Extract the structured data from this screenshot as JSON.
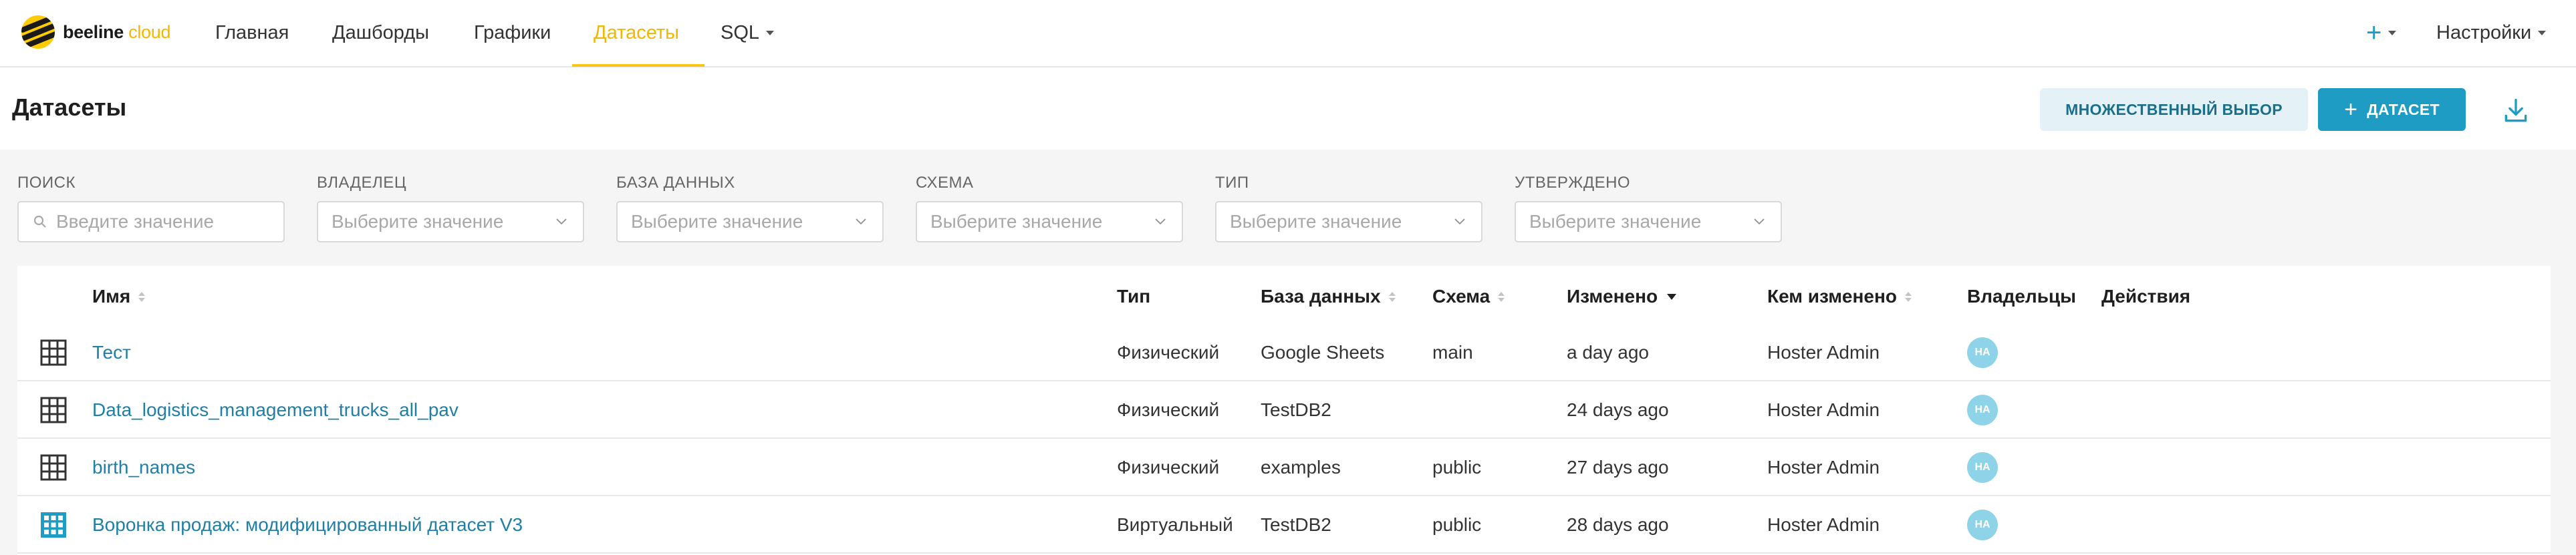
{
  "app": {
    "logo_text_main": "beeline",
    "logo_text_accent": "cloud"
  },
  "nav": {
    "items": [
      {
        "label": "Главная"
      },
      {
        "label": "Дашборды"
      },
      {
        "label": "Графики"
      },
      {
        "label": "Датасеты"
      },
      {
        "label": "SQL"
      }
    ],
    "active": "Датасеты",
    "plus_label": "+",
    "settings_label": "Настройки"
  },
  "header": {
    "title": "Датасеты",
    "bulk_select_label": "МНОЖЕСТВЕННЫЙ ВЫБОР",
    "add_dataset_label": "ДАТАСЕТ",
    "add_dataset_icon": "+"
  },
  "filters": [
    {
      "label": "ПОИСК",
      "placeholder": "Введите значение"
    },
    {
      "label": "ВЛАДЕЛЕЦ",
      "placeholder": "Выберите значение"
    },
    {
      "label": "БАЗА ДАННЫХ",
      "placeholder": "Выберите значение"
    },
    {
      "label": "СХЕМА",
      "placeholder": "Выберите значение"
    },
    {
      "label": "ТИП",
      "placeholder": "Выберите значение"
    },
    {
      "label": "УТВЕРЖДЕНО",
      "placeholder": "Выберите значение"
    }
  ],
  "table": {
    "columns": {
      "name": "Имя",
      "type": "Тип",
      "database": "База данных",
      "schema": "Схема",
      "modified": "Изменено",
      "modified_by": "Кем изменено",
      "owners": "Владельцы",
      "actions": "Действия"
    },
    "rows": [
      {
        "kind": "physical",
        "name": "Тест",
        "type": "Физический",
        "database": "Google Sheets",
        "schema": "main",
        "modified": "a day ago",
        "modified_by": "Hoster Admin",
        "owner_initials": "HA"
      },
      {
        "kind": "physical",
        "name": "Data_logistics_management_trucks_all_pav",
        "type": "Физический",
        "database": "TestDB2",
        "schema": "",
        "modified": "24 days ago",
        "modified_by": "Hoster Admin",
        "owner_initials": "HA"
      },
      {
        "kind": "physical",
        "name": "birth_names",
        "type": "Физический",
        "database": "examples",
        "schema": "public",
        "modified": "27 days ago",
        "modified_by": "Hoster Admin",
        "owner_initials": "HA"
      },
      {
        "kind": "virtual",
        "name": "Воронка продаж: модифицированный датасет V3",
        "type": "Виртуальный",
        "database": "TestDB2",
        "schema": "public",
        "modified": "28 days ago",
        "modified_by": "Hoster Admin",
        "owner_initials": "HA"
      }
    ]
  },
  "colors": {
    "brand_yellow": "#fecc00",
    "active_nav": "#f2b705",
    "primary": "#1e9cc4",
    "link": "#1f7fa6",
    "avatar": "#8fd3e8"
  }
}
